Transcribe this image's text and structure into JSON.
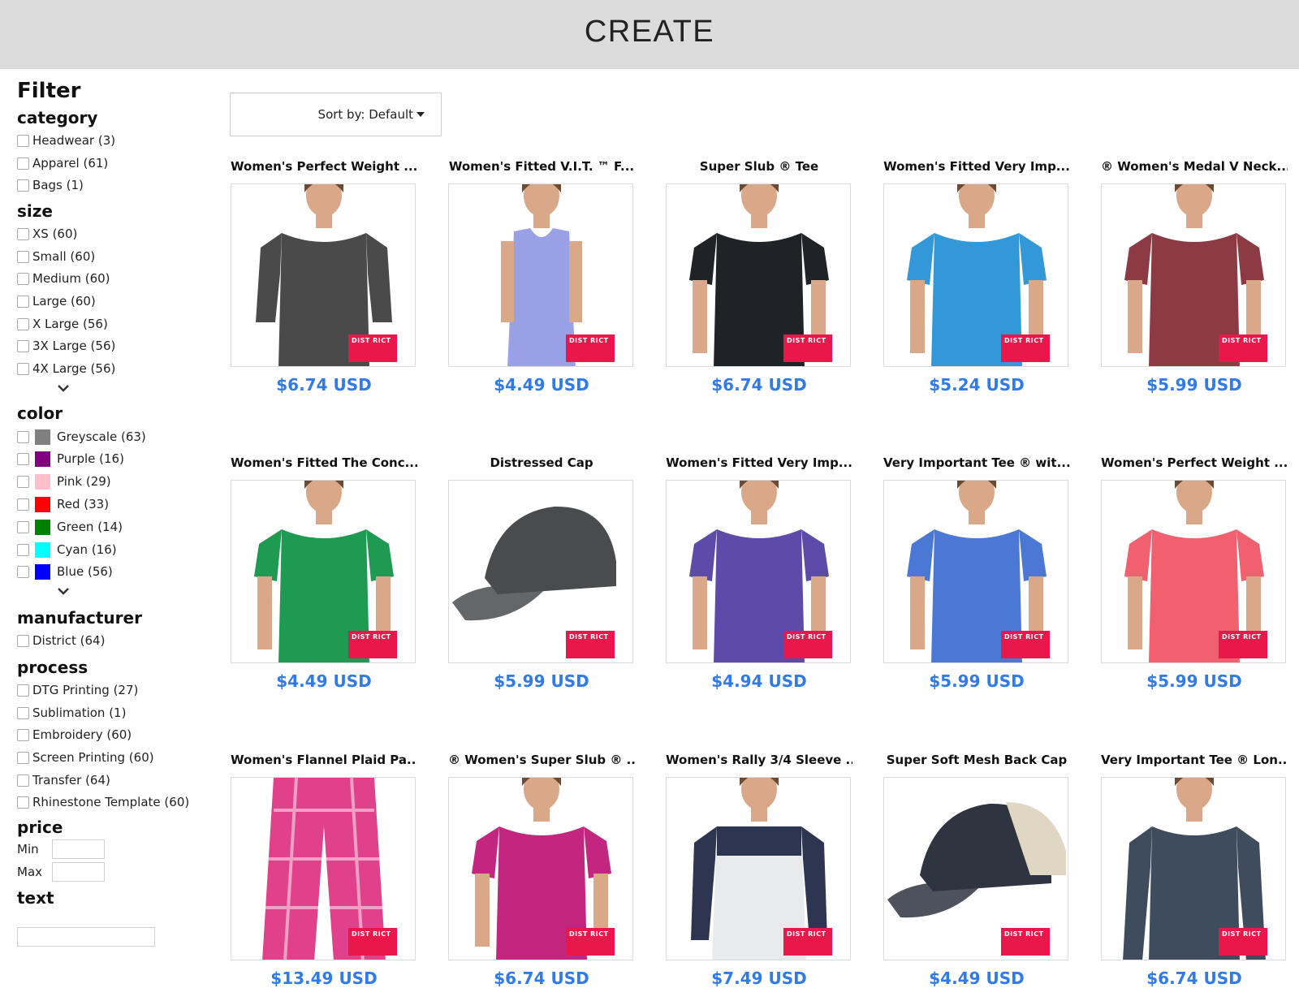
{
  "header": {
    "title": "CREATE"
  },
  "colors": {
    "header_bg": "#dcdcdc",
    "price": "#2f7bea",
    "brand_tag": "#e8194a"
  },
  "filter": {
    "title": "Filter",
    "category": {
      "title": "category",
      "options": [
        "Headwear (3)",
        "Apparel (61)",
        "Bags (1)"
      ]
    },
    "size": {
      "title": "size",
      "options": [
        "XS (60)",
        "Small (60)",
        "Medium (60)",
        "Large (60)",
        "X Large (56)",
        "3X Large (56)",
        "4X Large (56)"
      ],
      "expand_icon": "chevron-down-icon"
    },
    "color": {
      "title": "color",
      "options": [
        {
          "label": "Greyscale (63)",
          "swatch": "#808080"
        },
        {
          "label": "Purple (16)",
          "swatch": "#800080"
        },
        {
          "label": "Pink (29)",
          "swatch": "#ffc0cb"
        },
        {
          "label": "Red (33)",
          "swatch": "#ff0000"
        },
        {
          "label": "Green (14)",
          "swatch": "#008000"
        },
        {
          "label": "Cyan (16)",
          "swatch": "#00ffff"
        },
        {
          "label": "Blue (56)",
          "swatch": "#0000ff"
        }
      ],
      "expand_icon": "chevron-down-icon"
    },
    "manufacturer": {
      "title": "manufacturer",
      "options": [
        "District (64)"
      ]
    },
    "process": {
      "title": "process",
      "options": [
        "DTG Printing (27)",
        "Sublimation (1)",
        "Embroidery (60)",
        "Screen Printing (60)",
        "Transfer (64)",
        "Rhinestone Template (60)"
      ]
    },
    "price": {
      "title": "price",
      "min_label": "Min",
      "max_label": "Max",
      "min_value": "",
      "max_value": ""
    },
    "text": {
      "title": "text",
      "value": ""
    }
  },
  "sort": {
    "label": "Sort by: Default"
  },
  "brand_tag": "DIST RICT",
  "products": [
    {
      "name": "Women's Perfect Weight ...",
      "price": "$6.74 USD",
      "kind": "tee-3q",
      "color": "#4a4a4a"
    },
    {
      "name": "Women's Fitted V.I.T. ™ F...",
      "price": "$4.49 USD",
      "kind": "tank",
      "color": "#9aa0e6"
    },
    {
      "name": "Super Slub ® Tee",
      "price": "$6.74 USD",
      "kind": "tee",
      "color": "#1f2226"
    },
    {
      "name": "Women's Fitted Very Imp...",
      "price": "$5.24 USD",
      "kind": "tee",
      "color": "#3398d8"
    },
    {
      "name": "® Women's Medal V Neck...",
      "price": "$5.99 USD",
      "kind": "tee",
      "color": "#8c3a44"
    },
    {
      "name": "Women's Fitted The Conc...",
      "price": "$4.49 USD",
      "kind": "tee",
      "color": "#1e9a52"
    },
    {
      "name": "Distressed Cap",
      "price": "$5.99 USD",
      "kind": "cap",
      "color": "#4a4b4d"
    },
    {
      "name": "Women's Fitted Very Imp...",
      "price": "$4.94 USD",
      "kind": "tee",
      "color": "#5c4ba8"
    },
    {
      "name": "Very Important Tee ® wit...",
      "price": "$5.99 USD",
      "kind": "tee",
      "color": "#4a78d4"
    },
    {
      "name": "Women's Perfect Weight ...",
      "price": "$5.99 USD",
      "kind": "tee",
      "color": "#f0606e"
    },
    {
      "name": "Women's Flannel Plaid Pa...",
      "price": "$13.49 USD",
      "kind": "pants",
      "color": "#e0418a"
    },
    {
      "name": "® Women's Super Slub ® ...",
      "price": "$6.74 USD",
      "kind": "tee",
      "color": "#c2267e"
    },
    {
      "name": "Women's Rally 3/4 Sleeve ...",
      "price": "$7.49 USD",
      "kind": "raglan",
      "color": "#2d3550"
    },
    {
      "name": "Super Soft Mesh Back Cap",
      "price": "$4.49 USD",
      "kind": "cap-mesh",
      "color": "#2e3440"
    },
    {
      "name": "Very Important Tee ® Lon...",
      "price": "$6.74 USD",
      "kind": "longsleeve",
      "color": "#3e4c5e"
    }
  ]
}
